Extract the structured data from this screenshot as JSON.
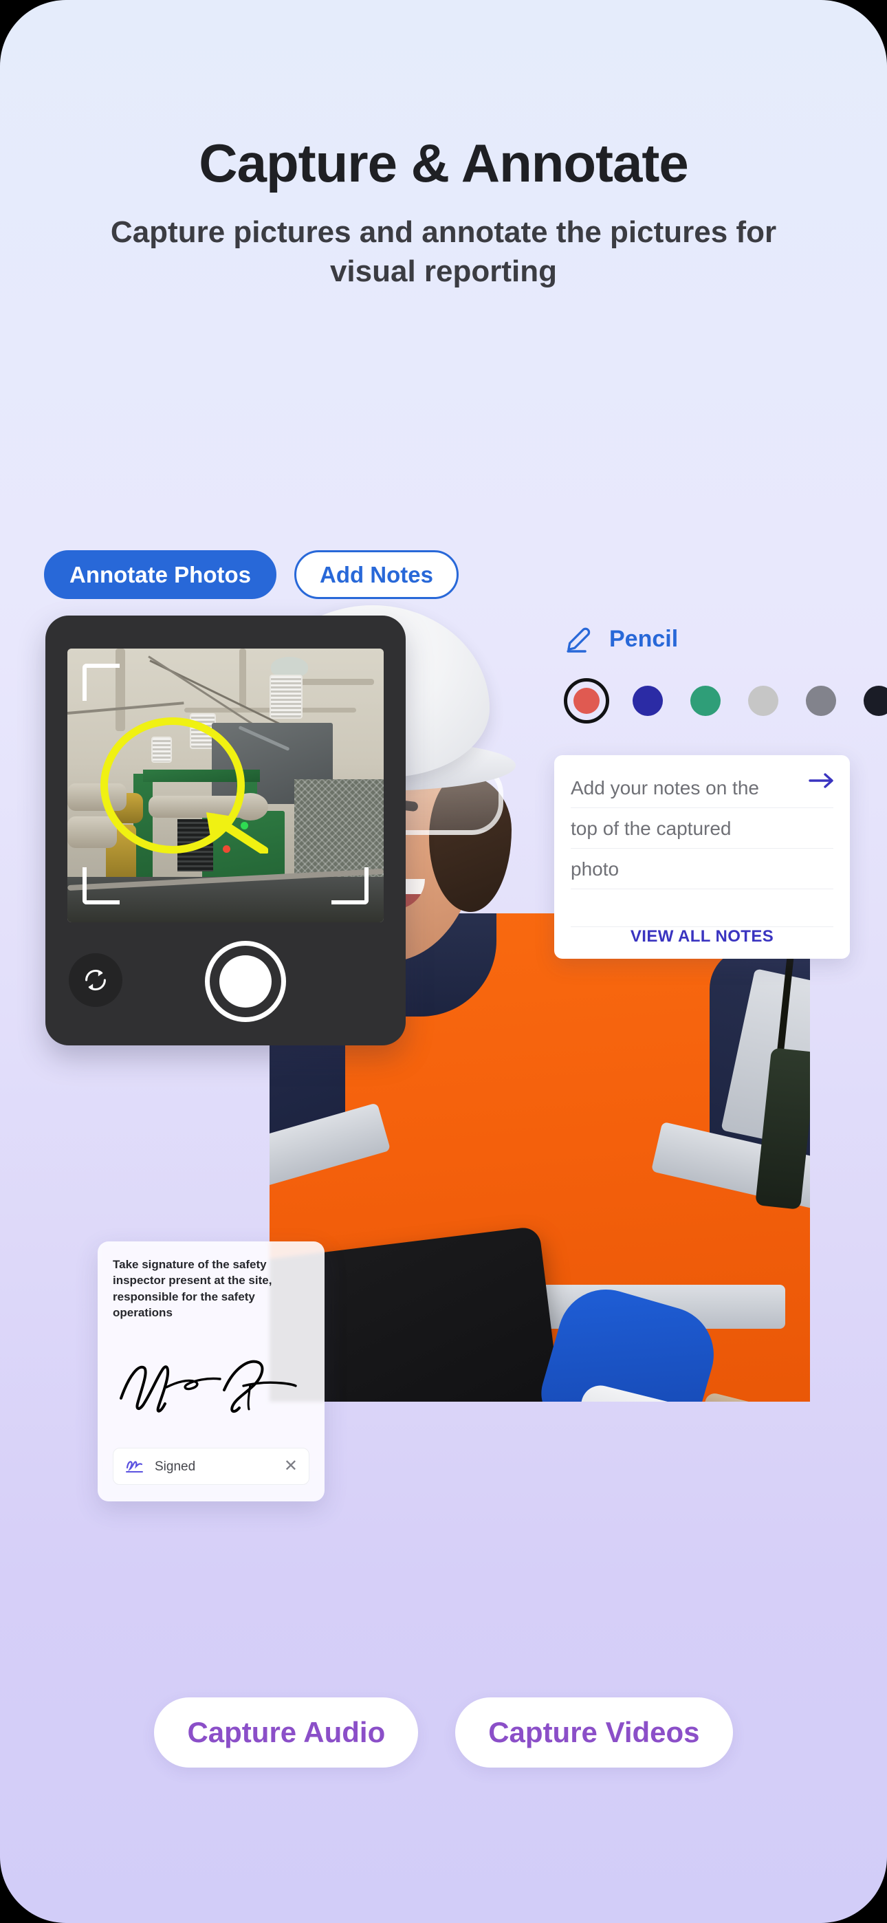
{
  "header": {
    "title": "Capture & Annotate",
    "subtitle": "Capture pictures and annotate the pictures for visual reporting"
  },
  "tabs": [
    {
      "label": "Annotate Photos",
      "state": "active"
    },
    {
      "label": "Add Notes",
      "state": "inactive"
    }
  ],
  "camera": {
    "flip_icon": "flip-camera-icon",
    "shutter_icon": "shutter-button",
    "annotation_color": "#f0f112"
  },
  "tool_panel": {
    "pencil_icon": "pencil-icon",
    "label": "Pencil",
    "swatches": [
      {
        "name": "red",
        "hex": "#e05a51",
        "selected": true
      },
      {
        "name": "indigo",
        "hex": "#2b2ba5",
        "selected": false
      },
      {
        "name": "green",
        "hex": "#2f9e78",
        "selected": false
      },
      {
        "name": "light-gray",
        "hex": "#c6c6c6",
        "selected": false
      },
      {
        "name": "gray",
        "hex": "#82838c",
        "selected": false
      },
      {
        "name": "black",
        "hex": "#1a1c26",
        "selected": false
      }
    ]
  },
  "notes_card": {
    "arrow_icon": "arrow-right-icon",
    "lines": [
      "Add your notes on the",
      "top of the captured",
      "photo"
    ],
    "view_all_label": "VIEW ALL NOTES"
  },
  "signature_card": {
    "instruction": "Take signature of the safety inspector present at the site, responsible for the safety operations",
    "signed_label": "Signed",
    "signature_icon": "signature-icon",
    "close_icon": "close-icon"
  },
  "bottom_buttons": [
    {
      "label": "Capture Audio"
    },
    {
      "label": "Capture Videos"
    }
  ],
  "colors": {
    "accent_blue": "#2868d8",
    "accent_purple": "#8b4fc8",
    "link_indigo": "#3a34c0",
    "bg_top": "#e5ecfb",
    "bg_bottom": "#d2cdf8"
  }
}
